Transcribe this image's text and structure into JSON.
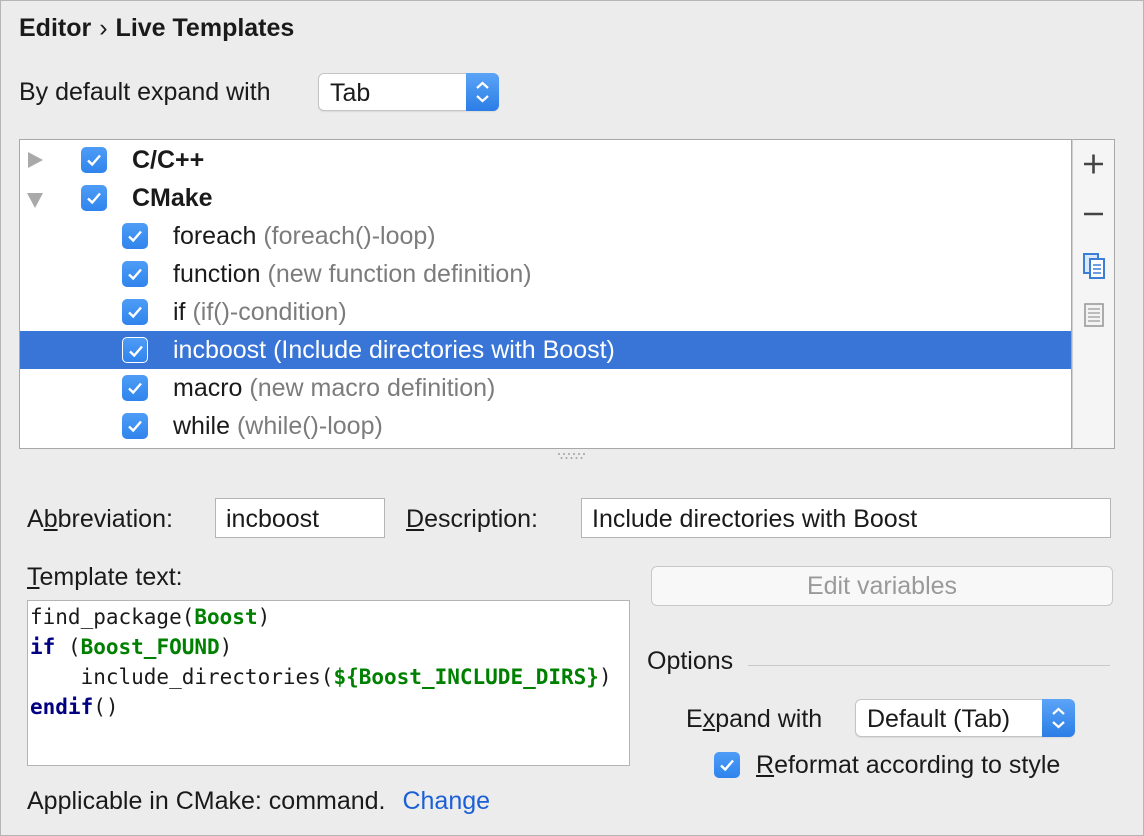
{
  "breadcrumb": {
    "parent": "Editor",
    "separator": "›",
    "current": "Live Templates"
  },
  "expand": {
    "label": "By default expand with",
    "value": "Tab"
  },
  "tree": {
    "groups": [
      {
        "name": "C/C++",
        "expanded": false,
        "checked": true
      },
      {
        "name": "CMake",
        "expanded": true,
        "checked": true
      }
    ],
    "items": [
      {
        "abbr": "foreach",
        "desc": "(foreach()-loop)",
        "checked": true,
        "selected": false
      },
      {
        "abbr": "function",
        "desc": "(new function definition)",
        "checked": true,
        "selected": false
      },
      {
        "abbr": "if",
        "desc": "(if()-condition)",
        "checked": true,
        "selected": false
      },
      {
        "abbr": "incboost",
        "desc": "(Include directories with Boost)",
        "checked": true,
        "selected": true
      },
      {
        "abbr": "macro",
        "desc": "(new macro definition)",
        "checked": true,
        "selected": false
      },
      {
        "abbr": "while",
        "desc": "(while()-loop)",
        "checked": true,
        "selected": false
      }
    ]
  },
  "toolbar": {
    "add_icon": "plus-icon",
    "remove_icon": "minus-icon",
    "copy_icon": "copy-icon",
    "restore_icon": "document-icon"
  },
  "abbreviation": {
    "label_prefix": "A",
    "label_underline": "b",
    "label_rest": "breviation:",
    "value": "incboost"
  },
  "description": {
    "label_underline": "D",
    "label_rest": "escription:",
    "value": "Include directories with Boost"
  },
  "template_text": {
    "label_underline": "T",
    "label_rest": "emplate text:",
    "lines": [
      {
        "plain": "find_package(",
        "green": "Boost",
        "tail": ")"
      },
      {
        "kw": "if",
        "plain": " (",
        "green": "Boost_FOUND",
        "tail": ")"
      },
      {
        "plain": "    include_directories(",
        "green": "${Boost_INCLUDE_DIRS}",
        "tail": ")"
      },
      {
        "kw": "endif",
        "tail": "()"
      }
    ]
  },
  "edit_variables": {
    "label": "Edit variables",
    "enabled": false
  },
  "options": {
    "title": "Options",
    "expand_label_prefix": "E",
    "expand_label_underline": "x",
    "expand_label_rest": "pand with",
    "expand_value": "Default (Tab)",
    "reformat_underline": "R",
    "reformat_rest": "eformat according to style",
    "reformat_checked": true
  },
  "applicable": {
    "text": "Applicable in CMake: command.",
    "link": "Change"
  },
  "colors": {
    "accent": "#3b8ef0",
    "selection": "#3875d7",
    "link": "#1a5fd6",
    "keyword": "#000080",
    "string": "#008000"
  }
}
